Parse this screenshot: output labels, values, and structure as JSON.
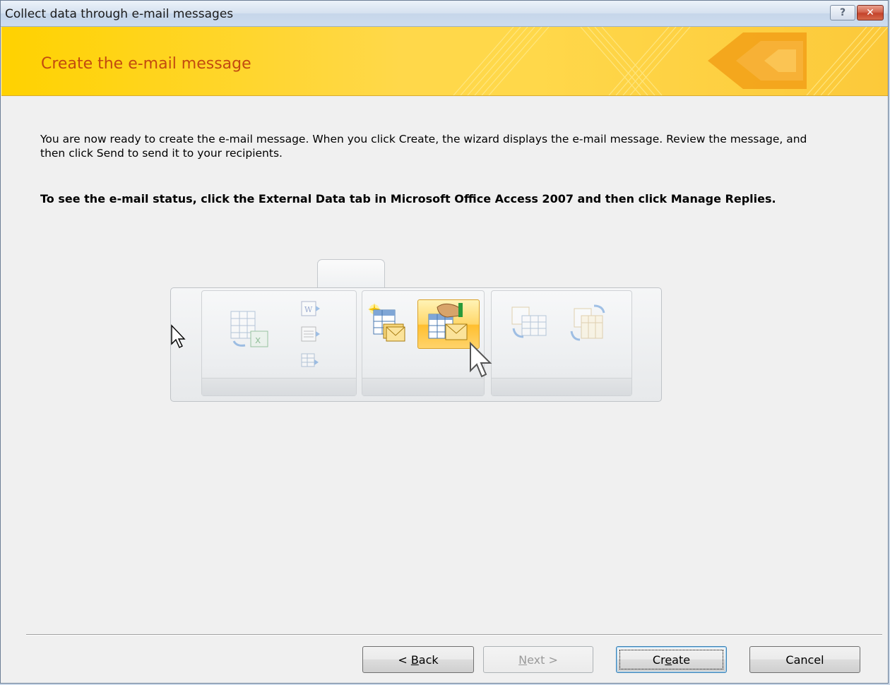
{
  "window": {
    "title": "Collect data through e-mail messages",
    "help_label": "?",
    "close_label": "X"
  },
  "header": {
    "title": "Create the e-mail message"
  },
  "content": {
    "intro": "You are now ready to create the e-mail message. When you click Create, the wizard displays the e-mail message. Review the message, and then click Send to send it to your recipients.",
    "status_note": "To see the e-mail status, click the External Data tab in Microsoft Office Access 2007 and then click Manage Replies."
  },
  "illustration": {
    "icons": [
      "excel-export-icon",
      "word-export-icon",
      "text-file-export-icon",
      "table-export-icon",
      "create-email-icon",
      "manage-replies-icon",
      "sync-icon",
      "move-table-icon"
    ],
    "highlighted": "manage-replies-icon",
    "colors": {
      "highlight": "#ffd769",
      "header": "#ffd200",
      "title_text": "#c24a10"
    }
  },
  "buttons": {
    "back": {
      "pre": "< ",
      "accel": "B",
      "post": "ack"
    },
    "next": {
      "pre": "",
      "accel": "N",
      "post": "ext >"
    },
    "create": {
      "pre": "Cr",
      "accel": "e",
      "post": "ate"
    },
    "cancel": {
      "label": "Cancel"
    }
  }
}
